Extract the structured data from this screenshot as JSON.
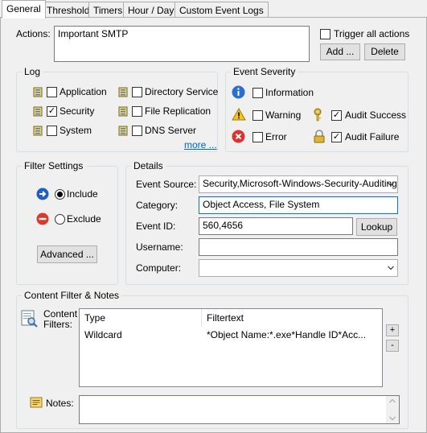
{
  "tabs": [
    "General",
    "Threshold",
    "Timers",
    "Hour / Day",
    "Custom Event Logs"
  ],
  "actions": {
    "label": "Actions:",
    "value": "Important SMTP",
    "trigger_all_label": "Trigger all actions",
    "trigger_all_checked": false,
    "add_label": "Add ...",
    "delete_label": "Delete"
  },
  "log": {
    "title": "Log",
    "items": [
      {
        "label": "Application",
        "checked": false
      },
      {
        "label": "Security",
        "checked": true
      },
      {
        "label": "System",
        "checked": false
      },
      {
        "label": "Directory Service",
        "checked": false
      },
      {
        "label": "File Replication",
        "checked": false
      },
      {
        "label": "DNS Server",
        "checked": false
      }
    ],
    "more_label": "more ..."
  },
  "severity": {
    "title": "Event Severity",
    "information": {
      "label": "Information",
      "checked": false
    },
    "warning": {
      "label": "Warning",
      "checked": false
    },
    "error": {
      "label": "Error",
      "checked": false
    },
    "audit_success": {
      "label": "Audit Success",
      "checked": true
    },
    "audit_failure": {
      "label": "Audit Failure",
      "checked": true
    }
  },
  "filter": {
    "title": "Filter Settings",
    "include_label": "Include",
    "exclude_label": "Exclude",
    "selected": "include",
    "advanced_label": "Advanced ..."
  },
  "details": {
    "title": "Details",
    "event_source_label": "Event Source:",
    "event_source_value": "Security,Microsoft-Windows-Security-Auditing",
    "category_label": "Category:",
    "category_value": "Object Access, File System",
    "event_id_label": "Event ID:",
    "event_id_value": "560,4656",
    "lookup_label": "Lookup",
    "username_label": "Username:",
    "username_value": "",
    "computer_label": "Computer:",
    "computer_value": ""
  },
  "content": {
    "title": "Content Filter & Notes",
    "filters_label_1": "Content",
    "filters_label_2": "Filters:",
    "columns": [
      "Type",
      "Filtertext"
    ],
    "rows": [
      {
        "type": "Wildcard",
        "text": "*Object Name:*.exe*Handle ID*Acc..."
      }
    ],
    "plus_label": "+",
    "minus_label": "-",
    "notes_label": "Notes:",
    "notes_value": ""
  },
  "colors": {
    "info_blue": "#2a6fcf",
    "include_blue": "#1f5fc4",
    "exclude_red": "#d93a2b",
    "error_red": "#e0322b",
    "warning_yellow": "#f5c518",
    "link_blue": "#0066cc",
    "focus_border": "#0078d7"
  }
}
